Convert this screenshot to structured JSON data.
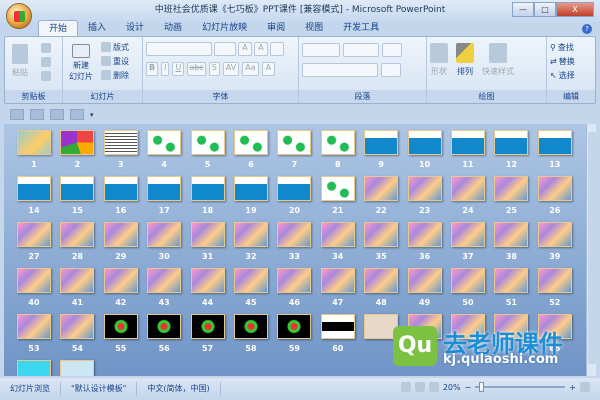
{
  "window": {
    "title": "中班社会优质课《七巧板》PPT课件 [兼容模式] - Microsoft PowerPoint",
    "minimize": "—",
    "maximize": "□",
    "close": "X"
  },
  "tabs": [
    "开始",
    "插入",
    "设计",
    "动画",
    "幻灯片放映",
    "审阅",
    "视图",
    "开发工具"
  ],
  "ribbon": {
    "clipboard": {
      "label": "剪贴板",
      "paste": "粘贴"
    },
    "slides": {
      "label": "幻灯片",
      "new_slide": "新建",
      "new_slide2": "幻灯片",
      "layout": "版式",
      "reset": "重设",
      "delete": "删除"
    },
    "font": {
      "label": "字体",
      "bold": "B",
      "italic": "I",
      "underline": "U",
      "strike": "abc",
      "shadow": "S",
      "spacing": "AV",
      "case": "Aa",
      "color": "A",
      "grow": "A",
      "shrink": "A"
    },
    "paragraph": {
      "label": "段落"
    },
    "drawing": {
      "label": "绘图",
      "shapes": "形状",
      "arrange": "排列",
      "quick_styles": "快速样式"
    },
    "editing": {
      "label": "编辑",
      "find": "查找",
      "replace": "替换",
      "select": "选择"
    }
  },
  "slides": {
    "kinds": [
      "title",
      "tangram",
      "text",
      "green",
      "green",
      "green",
      "green",
      "green",
      "blue",
      "blue",
      "blue",
      "blue",
      "blue",
      "blue",
      "blue",
      "blue",
      "blue",
      "blue",
      "blue",
      "blue",
      "green",
      "photo",
      "photo",
      "photo",
      "photo",
      "photo",
      "photo",
      "photo",
      "photo",
      "photo",
      "photo",
      "photo",
      "photo",
      "photo",
      "photo",
      "photo",
      "photo",
      "photo",
      "photo",
      "photo",
      "photo",
      "photo",
      "photo",
      "photo",
      "photo",
      "photo",
      "photo",
      "photo",
      "photo",
      "photo",
      "photo",
      "photo",
      "photo",
      "photo",
      "black",
      "black",
      "black",
      "black",
      "black",
      "blackwhite",
      "beige",
      "photo",
      "photo",
      "photo",
      "photo",
      "cyan",
      "light"
    ],
    "visible_numbers": [
      1,
      2,
      3,
      4,
      5,
      6,
      7,
      8,
      9,
      10,
      11,
      12,
      13,
      14,
      15,
      16,
      17,
      18,
      19,
      20,
      21,
      22,
      23,
      24,
      25,
      26,
      27,
      28,
      29,
      30,
      31,
      32,
      33,
      34,
      35,
      36,
      37,
      38,
      39,
      40,
      41,
      42,
      43,
      44,
      45,
      46,
      47,
      48,
      49,
      50,
      51,
      52,
      53,
      54,
      55,
      56,
      57,
      58,
      59,
      60,
      65
    ]
  },
  "status": {
    "view": "幻灯片浏览",
    "theme": "\"默认设计模板\"",
    "language": "中文(简体，中国)",
    "zoom": "20%",
    "zoom_minus": "−",
    "zoom_plus": "+"
  },
  "watermark": {
    "logo": "Qu",
    "name": "去老师课件",
    "url": "kj.qulaoshi.com"
  }
}
